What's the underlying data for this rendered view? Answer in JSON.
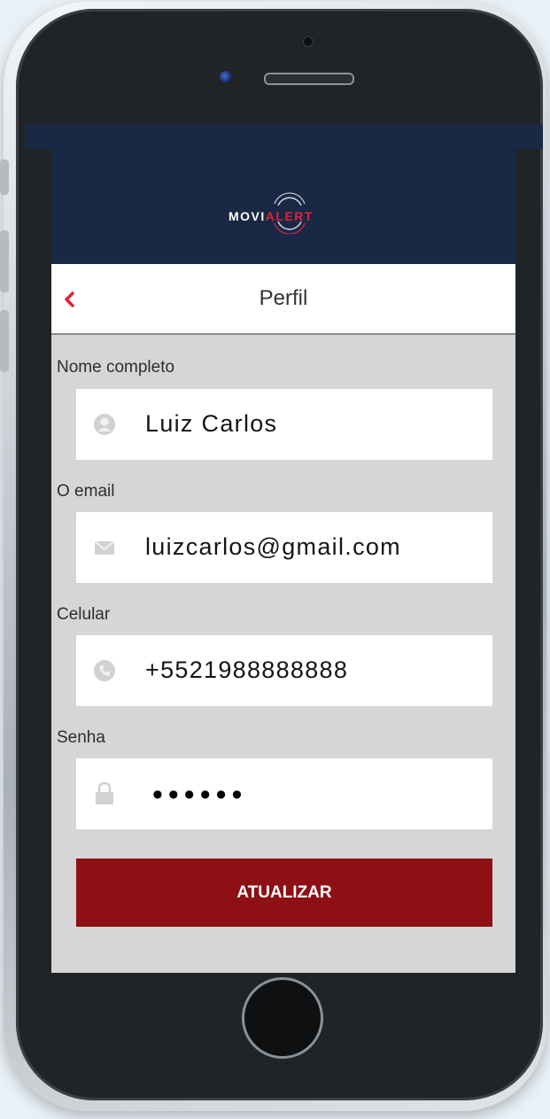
{
  "app": {
    "brand_prefix": "MOVI",
    "brand_suffix": "ALERT"
  },
  "nav": {
    "title": "Perfil",
    "back_icon": "chevron-left-icon"
  },
  "form": {
    "fields": [
      {
        "label": "Nome completo",
        "value": "Luiz Carlos",
        "icon": "user-icon"
      },
      {
        "label": "O email",
        "value": "luizcarlos@gmail.com",
        "icon": "envelope-icon"
      },
      {
        "label": "Celular",
        "value": "+5521988888888",
        "icon": "phone-icon"
      },
      {
        "label": "Senha",
        "value": "••••••",
        "icon": "lock-icon"
      }
    ],
    "submit_label": "ATUALIZAR"
  },
  "colors": {
    "header_bg": "#192844",
    "accent_red": "#e0223a",
    "button_bg": "#8e0f14",
    "screen_bg": "#d6d6d6"
  }
}
